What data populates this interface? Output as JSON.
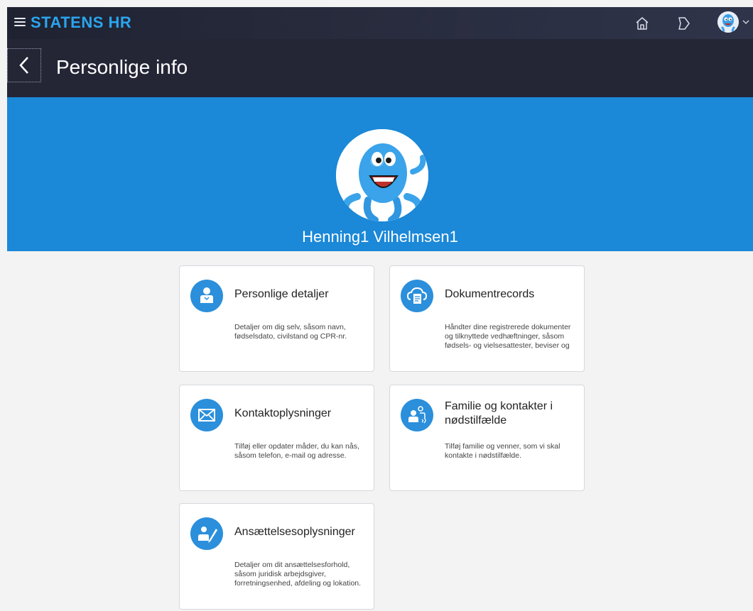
{
  "header": {
    "brand": "STATENS HR",
    "menu_icon": "hamburger-icon",
    "home_icon": "home-icon",
    "notifications_icon": "bell-icon",
    "user_avatar_icon": "octopus-avatar"
  },
  "page": {
    "title": "Personlige info",
    "back_icon": "chevron-left-icon"
  },
  "profile": {
    "name": "Henning1 Vilhelmsen1"
  },
  "cards": [
    {
      "icon": "person-icon",
      "title": "Personlige detaljer",
      "description": "Detaljer om dig selv, såsom navn, fødselsdato, civilstand og CPR-nr."
    },
    {
      "icon": "document-cloud-icon",
      "title": "Dokumentrecords",
      "description": "Håndter dine registrerede dokumenter og tilknyttede vedhæftninger, såsom fødsels- og vielsesattester, beviser og"
    },
    {
      "icon": "envelope-icon",
      "title": "Kontaktoplysninger",
      "description": "Tilføj eller opdater måder, du kan nås, såsom telefon, e-mail og adresse."
    },
    {
      "icon": "family-contacts-icon",
      "title": "Familie og kontakter i nødstilfælde",
      "description": "Tilføj familie og venner, som vi skal kontakte i nødstilfælde."
    },
    {
      "icon": "employment-icon",
      "title": "Ansættelsesoplysninger",
      "description": "Detaljer om dit ansættelsesforhold, såsom juridisk arbejdsgiver, forretningsenhed, afdeling og lokation."
    }
  ],
  "colors": {
    "brand": "#2aa5ef",
    "banner": "#1b88d8",
    "icon_circle": "#2b8fdb",
    "header": "#242636"
  }
}
